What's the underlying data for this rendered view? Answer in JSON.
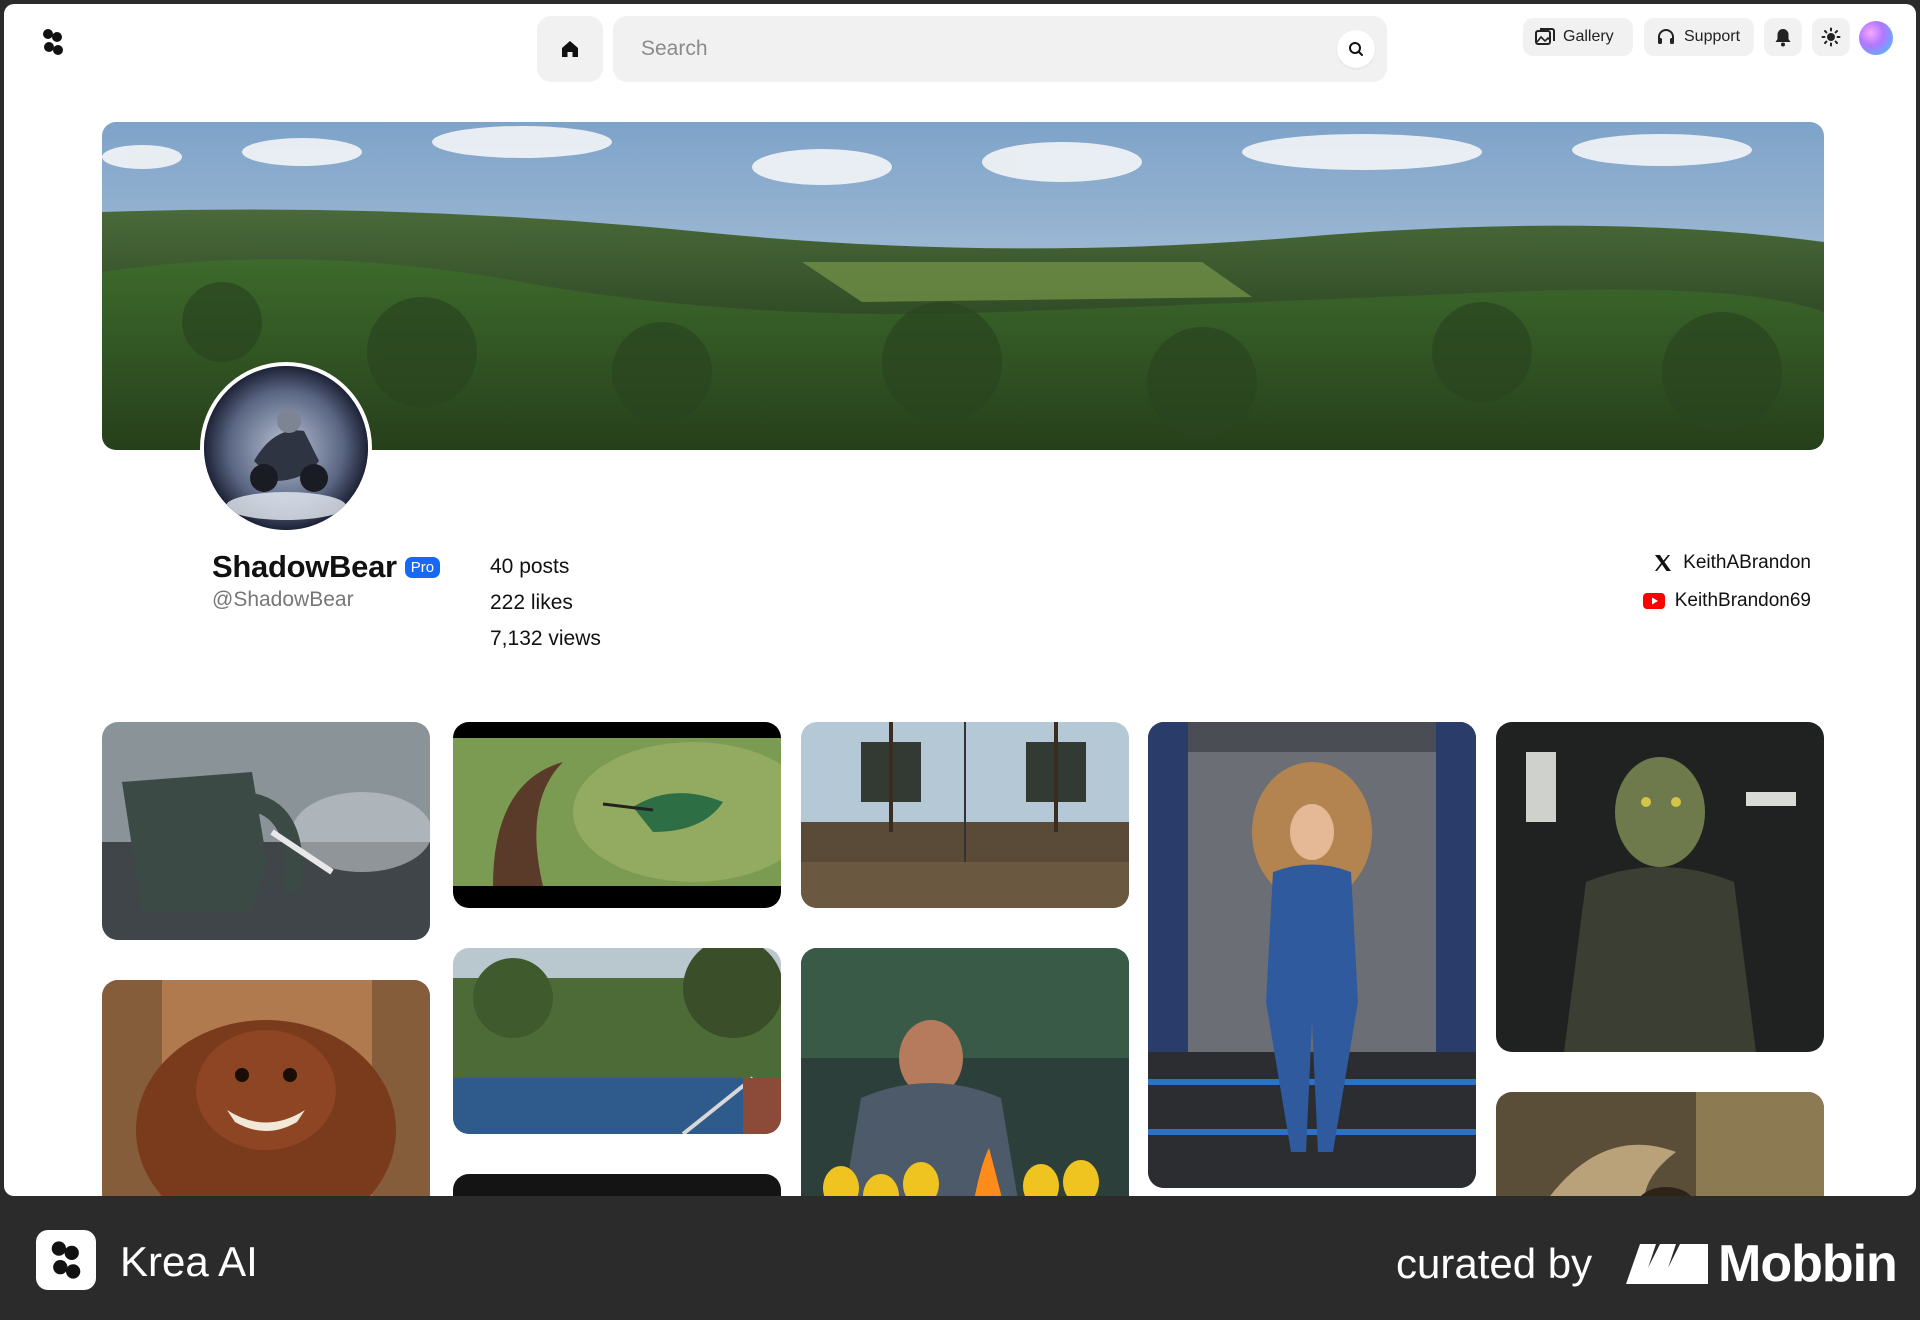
{
  "header": {
    "search_placeholder": "Search",
    "gallery_label": "Gallery",
    "support_label": "Support"
  },
  "profile": {
    "username": "ShadowBear",
    "badge": "Pro",
    "handle": "@ShadowBear",
    "stats": {
      "posts": "40 posts",
      "likes": "222 likes",
      "views": "7,132 views"
    },
    "social": {
      "x_handle": "KeithABrandon",
      "youtube_handle": "KeithBrandon69"
    }
  },
  "gallery": {
    "tiles": [
      "robotic-elephant",
      "hummingbird",
      "pirate-ship-deck",
      "woman-in-spaceship-corridor",
      "reptilian-soldier",
      "furry-monster",
      "backyard-pool",
      "dark-tile",
      "man-at-campfire-with-minions",
      "winged-creature"
    ]
  },
  "footer": {
    "app_name": "Krea AI",
    "curated_by": "curated by",
    "brand": "Mobbin"
  },
  "colors": {
    "accent": "#1669f5",
    "youtube": "#ff0000",
    "footer_bg": "#2b2b2b"
  }
}
